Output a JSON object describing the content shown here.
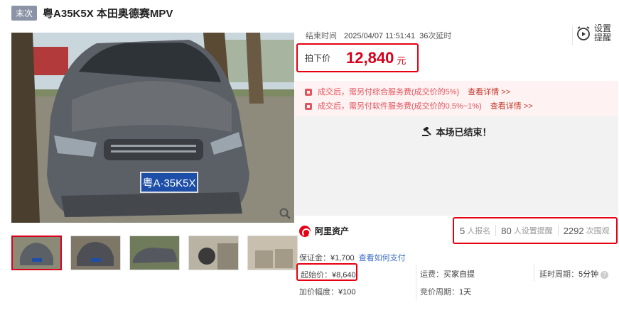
{
  "header": {
    "tag": "末次",
    "title": "粤A35K5X 本田奥德赛MPV"
  },
  "auction": {
    "end_label": "结束时间",
    "end_time": "2025/04/07 11:51:41",
    "delay_count": "36",
    "delay_label": "次延时",
    "price_label": "拍下价",
    "price": "12,840",
    "price_unit": "元",
    "reminder_label_1": "设置",
    "reminder_label_2": "提醒"
  },
  "fees": [
    {
      "text": "成交后，需另付综合服务费(成交价的5%)",
      "link": "查看详情 >>"
    },
    {
      "text": "成交后，需另付软件服务费(成交价的0.5%~1%)",
      "link": "查看详情 >>"
    }
  ],
  "status": {
    "ended_text": "本场已结束！"
  },
  "brand": {
    "name": "阿里资产"
  },
  "stats": {
    "signups": "5",
    "signups_label": "人报名",
    "reminders": "80",
    "reminders_label": "人设置提醒",
    "views": "2292",
    "views_label": "次围观"
  },
  "details": {
    "deposit_label": "保证金：",
    "deposit": "¥1,700",
    "deposit_link": "查看如何支付",
    "start_label": "起始价：",
    "start": "¥8,640",
    "fare_label": "运费：",
    "fare": "买家自提",
    "delay_label": "延时周期：",
    "delay": "5分钟",
    "increment_label": "加价幅度：",
    "increment": "¥100",
    "cycle_label": "竞价周期：",
    "cycle": "1天"
  },
  "plate_text": "粤A·35K5X",
  "colors": {
    "accent": "#d9001b",
    "highlight_border": "#e60012",
    "link": "#3b6cc7"
  }
}
